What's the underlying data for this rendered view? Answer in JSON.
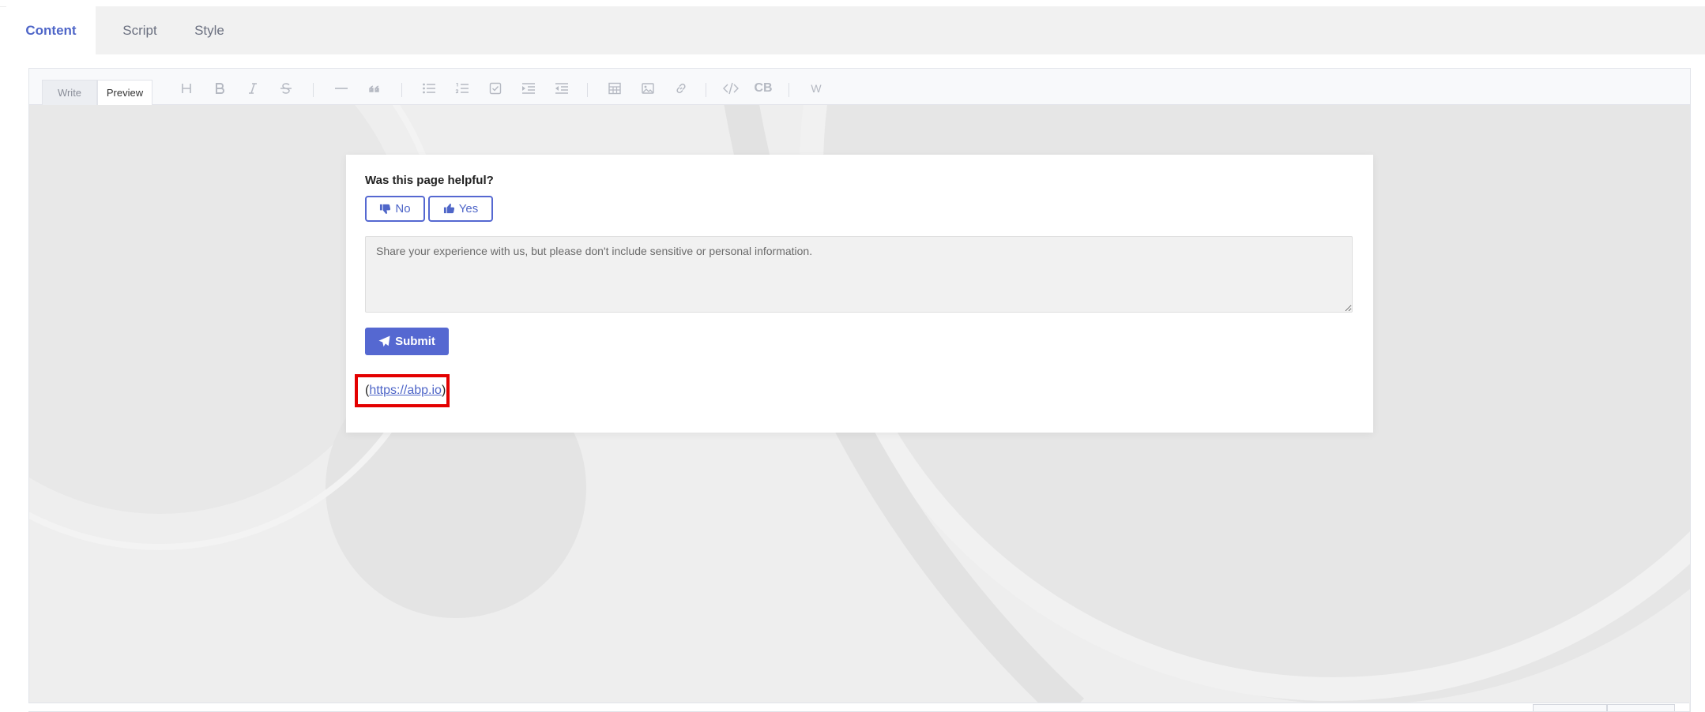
{
  "tabs": [
    {
      "label": "Content",
      "active": true
    },
    {
      "label": "Script",
      "active": false
    },
    {
      "label": "Style",
      "active": false
    }
  ],
  "editor": {
    "modes": [
      {
        "label": "Write",
        "active": false
      },
      {
        "label": "Preview",
        "active": true
      }
    ],
    "toolbar_icons": [
      "heading-icon",
      "bold-icon",
      "italic-icon",
      "strikethrough-icon",
      "horizontal-rule-icon",
      "quote-icon",
      "bullet-list-icon",
      "numbered-list-icon",
      "task-list-icon",
      "indent-icon",
      "outdent-icon",
      "table-icon",
      "image-icon",
      "link-icon",
      "code-icon",
      "code-block-icon",
      "widget-icon"
    ],
    "toolbar_text": {
      "code_block": "CB",
      "widget": "W"
    }
  },
  "preview": {
    "question": "Was this page helpful?",
    "no_label": "No",
    "yes_label": "Yes",
    "feedback_placeholder": "Share your experience with us, but please don't include sensitive or personal information.",
    "submit_label": "Submit",
    "link_open": "(",
    "link_text": "https://abp.io",
    "link_close": ")"
  },
  "colors": {
    "accent": "#5568d1",
    "highlight": "#e30000"
  }
}
